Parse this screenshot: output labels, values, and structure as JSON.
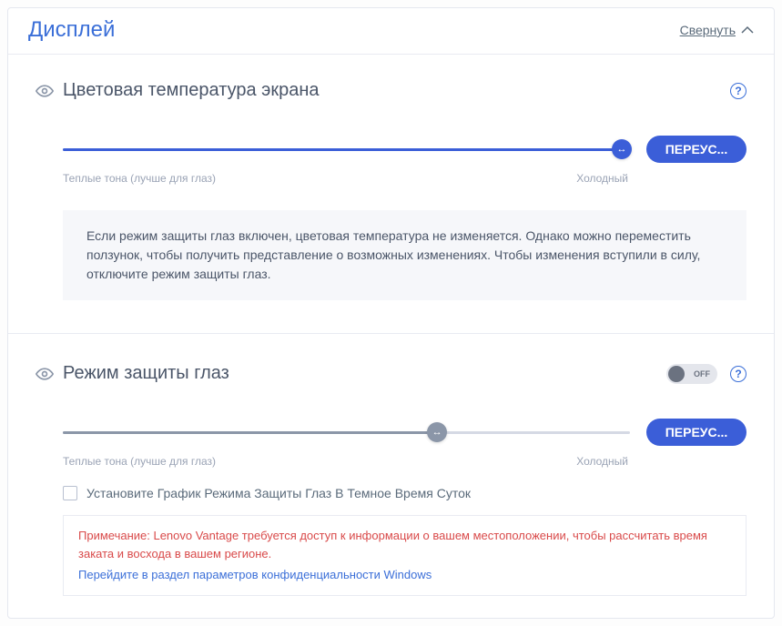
{
  "panel": {
    "title": "Дисплей",
    "collapse_label": "Свернуть"
  },
  "color_temp": {
    "title": "Цветовая температура экрана",
    "warm_label": "Теплые тона (лучше для глаз)",
    "cold_label": "Холодный",
    "reset_label": "ПЕРЕУС...",
    "info": "Если режим защиты глаз включен, цветовая температура не изменяется. Однако можно переместить ползунок, чтобы получить представление о возможных изменениях. Чтобы изменения вступили в силу, отключите режим защиты глаз."
  },
  "eye_care": {
    "title": "Режим защиты глаз",
    "toggle_state": "OFF",
    "warm_label": "Теплые тона (лучше для глаз)",
    "cold_label": "Холодный",
    "reset_label": "ПЕРЕУС...",
    "checkbox_label": "Установите График Режима Защиты Глаз В Темное Время Суток",
    "note_text": "Примечание: Lenovo Vantage требуется доступ к информации о вашем местоположении, чтобы рассчитать время заката и восхода в вашем регионе.",
    "note_link": "Перейдите в раздел параметров конфиденциальности Windows"
  },
  "colors": {
    "accent": "#3b5ed8",
    "danger": "#d94a4a"
  }
}
